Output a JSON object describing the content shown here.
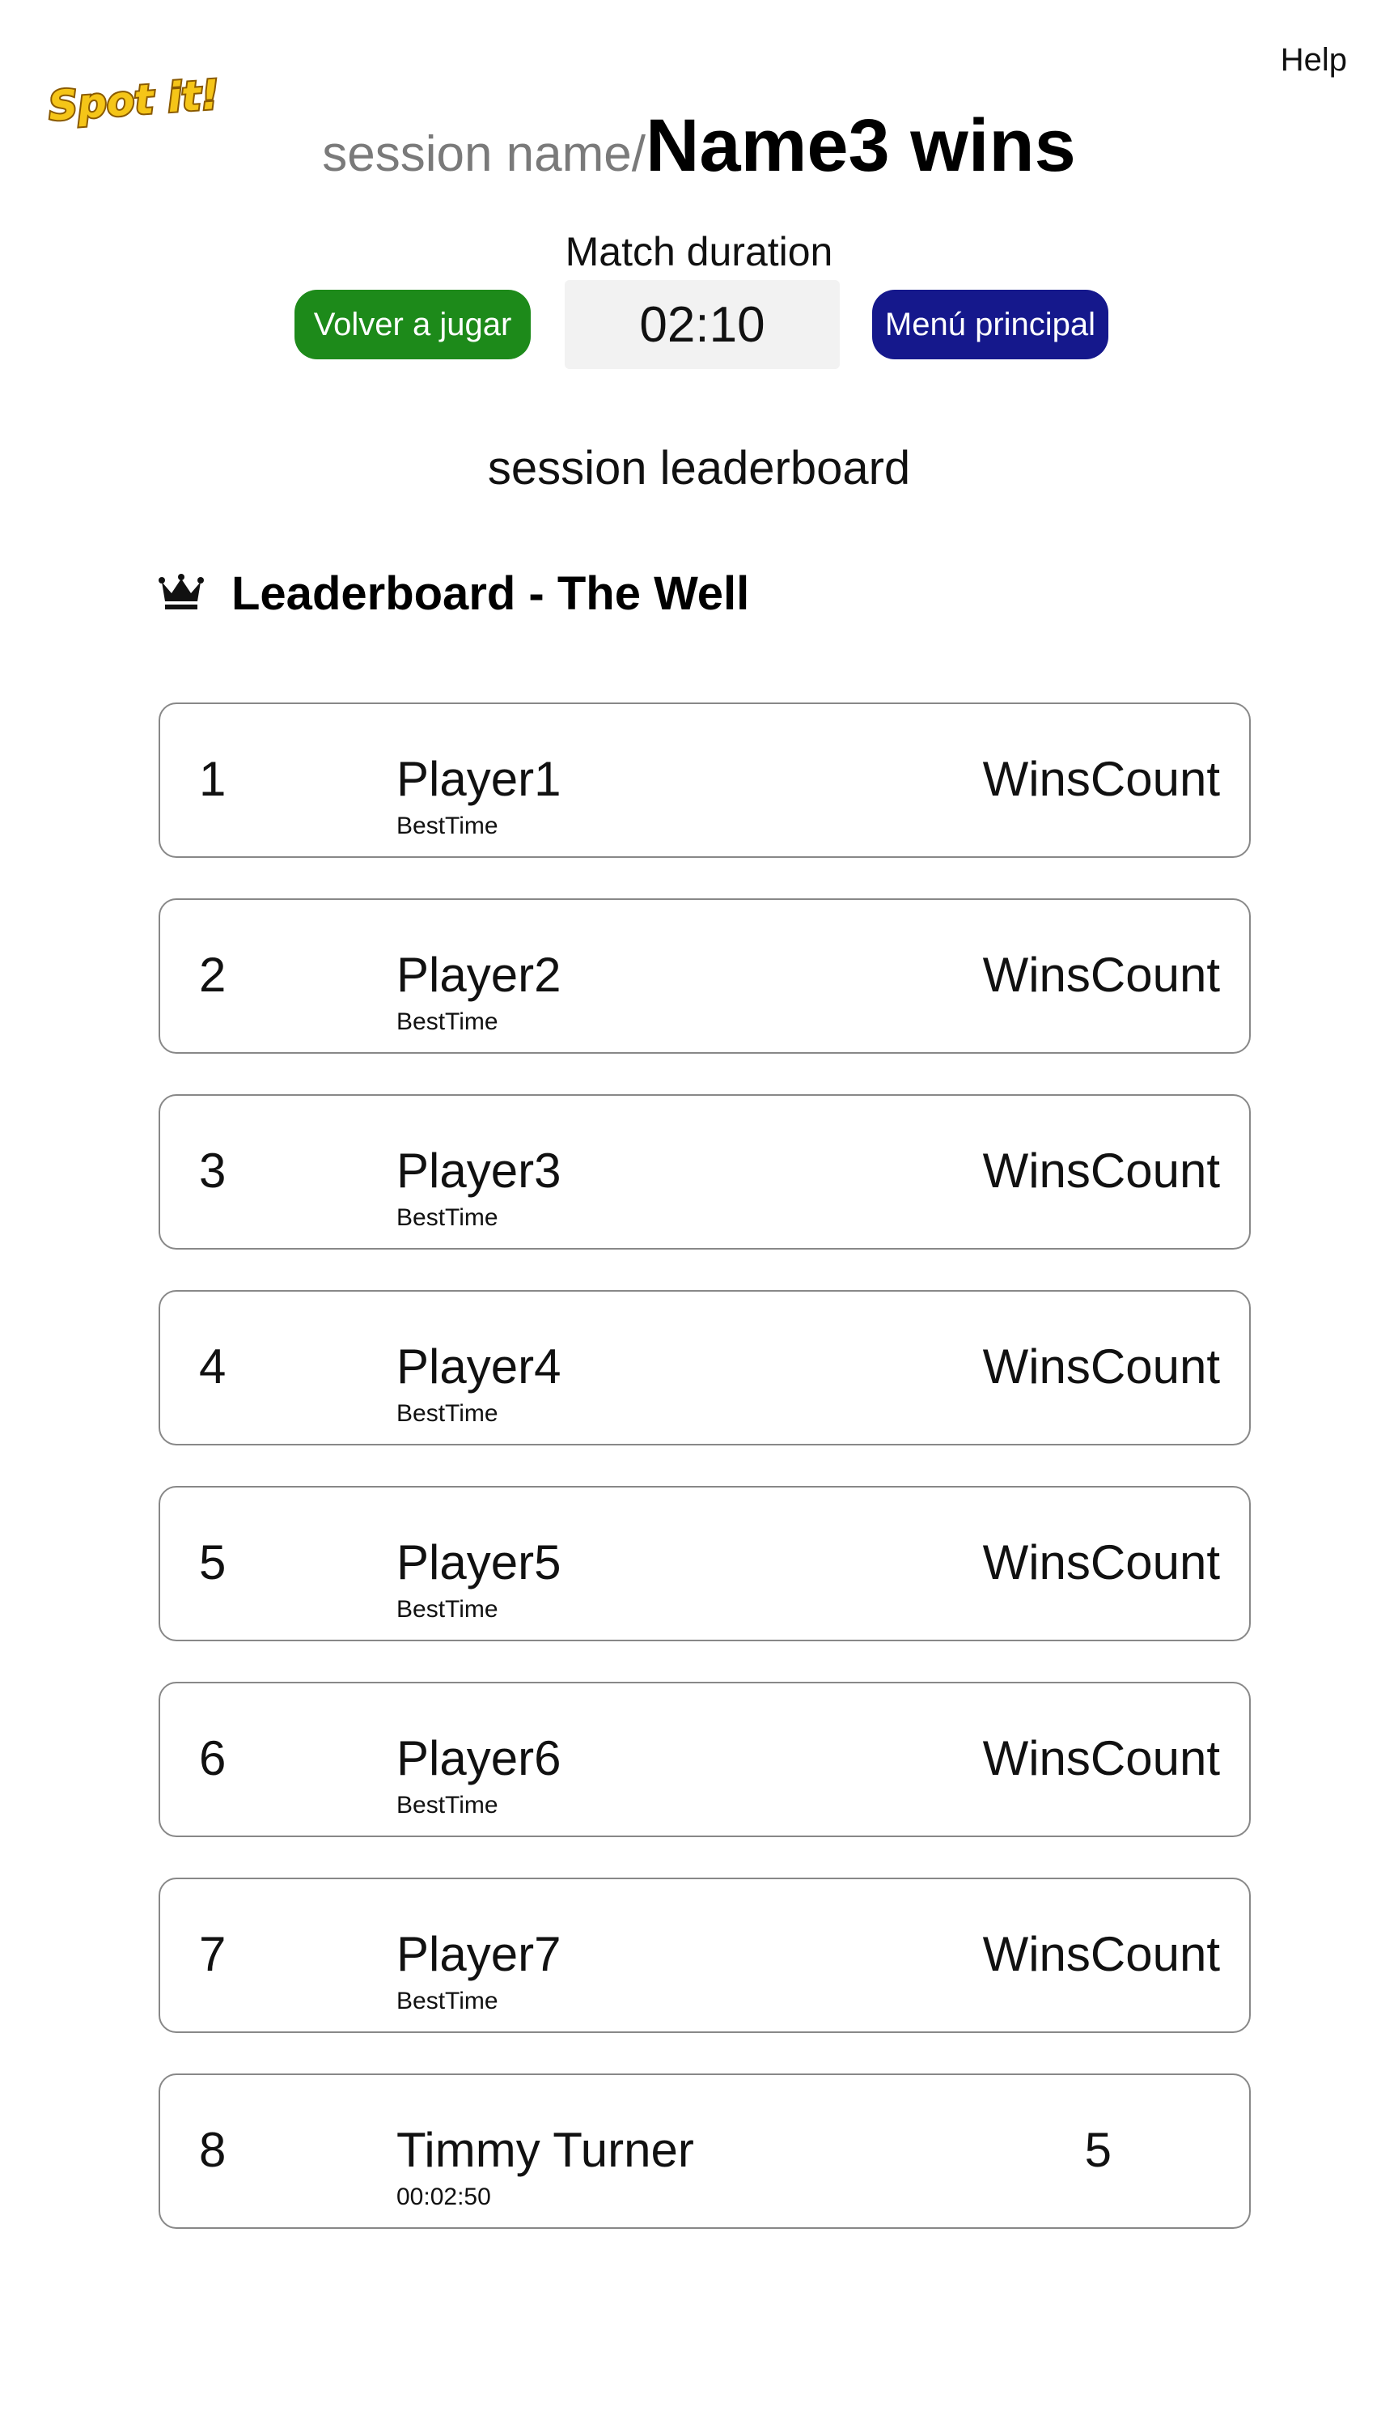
{
  "header": {
    "logo_text": "Spot it!",
    "help_label": "Help"
  },
  "title": {
    "session_name": "session name/",
    "winner_text": "Name3 wins"
  },
  "match": {
    "duration_label": "Match duration",
    "duration_value": "02:10",
    "replay_label": "Volver a jugar",
    "menu_label": "Menú principal"
  },
  "colors": {
    "replay_button": "#1d8a1a",
    "menu_button": "#15188c",
    "logo_yellow": "#f5c518"
  },
  "session_leaderboard_label": "session leaderboard",
  "leaderboard": {
    "icon": "crown-icon",
    "title": "Leaderboard - The Well",
    "rows": [
      {
        "rank": "1",
        "name": "Player1",
        "time": "BestTime",
        "wins": "WinsCount"
      },
      {
        "rank": "2",
        "name": "Player2",
        "time": "BestTime",
        "wins": "WinsCount"
      },
      {
        "rank": "3",
        "name": "Player3",
        "time": "BestTime",
        "wins": "WinsCount"
      },
      {
        "rank": "4",
        "name": "Player4",
        "time": "BestTime",
        "wins": "WinsCount"
      },
      {
        "rank": "5",
        "name": "Player5",
        "time": "BestTime",
        "wins": "WinsCount"
      },
      {
        "rank": "6",
        "name": "Player6",
        "time": "BestTime",
        "wins": "WinsCount"
      },
      {
        "rank": "7",
        "name": "Player7",
        "time": "BestTime",
        "wins": "WinsCount"
      },
      {
        "rank": "8",
        "name": "Timmy Turner",
        "time": "00:02:50",
        "wins": "5"
      }
    ]
  }
}
